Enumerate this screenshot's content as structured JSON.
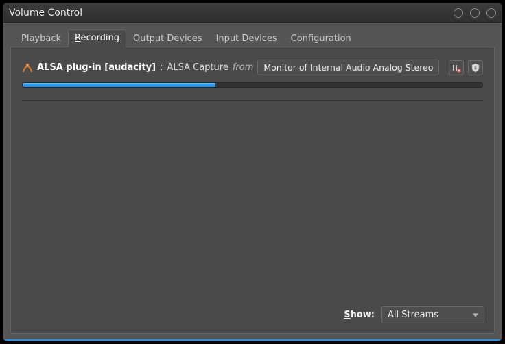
{
  "window": {
    "title": "Volume Control"
  },
  "tabs": [
    {
      "label": "Playback",
      "accel_index": 0
    },
    {
      "label": "Recording",
      "accel_index": 0
    },
    {
      "label": "Output Devices",
      "accel_index": 0
    },
    {
      "label": "Input Devices",
      "accel_index": 0
    },
    {
      "label": "Configuration",
      "accel_index": 0
    }
  ],
  "active_tab": 1,
  "stream": {
    "app_name": "ALSA plug-in [audacity]",
    "stream_desc": "ALSA Capture",
    "from_label": "from",
    "source_selected": "Monitor of Internal Audio Analog Stereo",
    "volume_percent": 42
  },
  "footer": {
    "show_label": "Show:",
    "show_selected": "All Streams"
  },
  "icons": {
    "mute_tooltip": "Mute",
    "lock_tooltip": "Lock channels"
  }
}
